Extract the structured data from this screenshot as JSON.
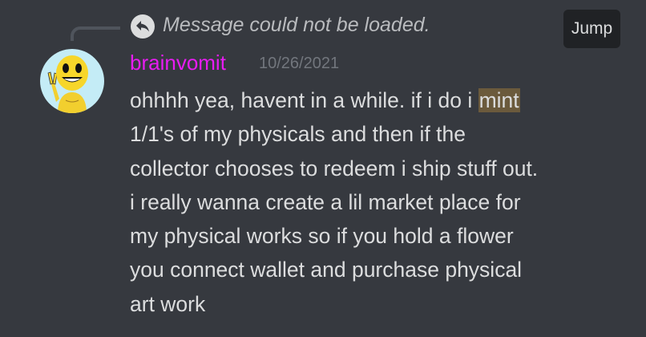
{
  "reply": {
    "text": "Message could not be loaded.",
    "icon": "reply-arrow-icon"
  },
  "jump_label": "Jump",
  "author": {
    "name": "brainvomit",
    "name_color": "#e81cf2",
    "timestamp": "10/26/2021",
    "avatar": "smiley-face-figure-avatar"
  },
  "message": {
    "line1_before": "ohhhh yea, havent in a while. if i do i ",
    "line1_highlight": "mint",
    "line2": "1/1's of my physicals and then if the",
    "line3": "collector chooses to redeem i ship stuff out.",
    "line4": "i really wanna create a lil market place for",
    "line5": "my physical works so if you hold a flower",
    "line6": "you connect wallet and purchase physical",
    "line7": "art work"
  },
  "colors": {
    "background": "#36393f",
    "highlight": "#6b5a3c",
    "jump_bg": "#202225"
  }
}
